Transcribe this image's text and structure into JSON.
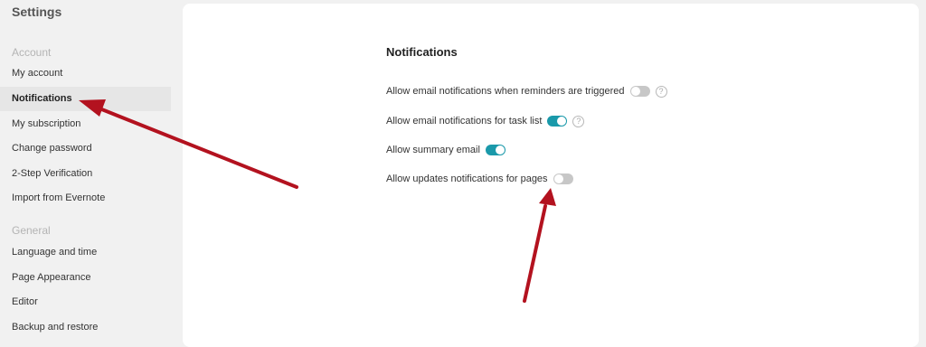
{
  "sidebar": {
    "title": "Settings",
    "account_label": "Account",
    "account_items": [
      "My account",
      "Notifications",
      "My subscription",
      "Change password",
      "2-Step Verification",
      "Import from Evernote"
    ],
    "general_label": "General",
    "general_items": [
      "Language and time",
      "Page Appearance",
      "Editor",
      "Backup and restore"
    ],
    "active_item": "Notifications"
  },
  "main": {
    "title": "Notifications",
    "settings": [
      {
        "label": "Allow email notifications when reminders are triggered",
        "enabled": false,
        "help": true
      },
      {
        "label": "Allow email notifications for task list",
        "enabled": true,
        "help": true
      },
      {
        "label": "Allow summary email",
        "enabled": true,
        "help": false
      },
      {
        "label": "Allow updates notifications for pages",
        "enabled": false,
        "help": false
      }
    ],
    "help_glyph": "?"
  },
  "colors": {
    "toggle_on": "#1a99aa",
    "toggle_off": "#c7c7c7",
    "annotation_arrow": "#b3121f"
  }
}
